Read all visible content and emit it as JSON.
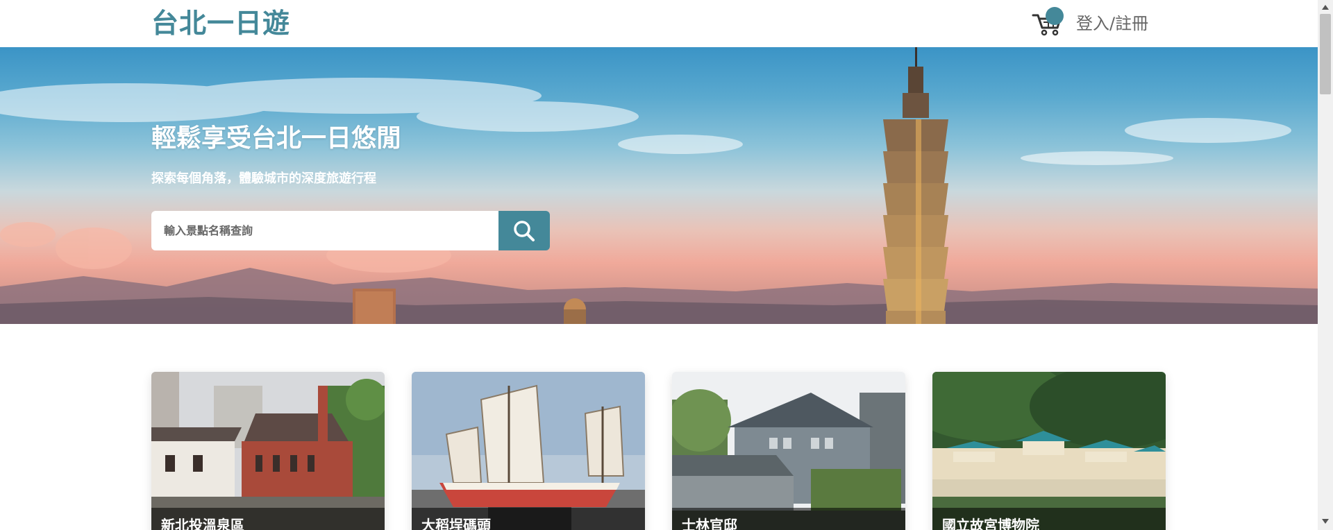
{
  "header": {
    "logo": "台北一日遊",
    "login_label": "登入/註冊",
    "cart_icon": "shopping-cart-icon"
  },
  "hero": {
    "title": "輕鬆享受台北一日悠閒",
    "subtitle": "探索每個角落，體驗城市的深度旅遊行程",
    "search_placeholder": "輸入景點名稱查詢",
    "search_icon": "search-icon"
  },
  "attractions": [
    {
      "name": "新北投溫泉區"
    },
    {
      "name": "大稻埕碼頭"
    },
    {
      "name": "士林官邸"
    },
    {
      "name": "國立故宮博物院"
    }
  ],
  "colors": {
    "brand": "#448899",
    "background": "#ffffff"
  }
}
